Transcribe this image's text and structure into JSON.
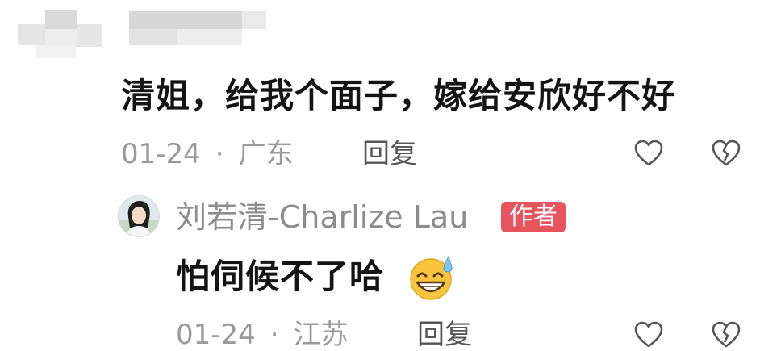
{
  "comment": {
    "text": "清姐，给我个面子，嫁给安欣好不好",
    "date": "01-24",
    "separator": "·",
    "location": "广东",
    "reply_label": "回复",
    "like_icon": "heart-outline-icon",
    "dislike_icon": "broken-heart-icon"
  },
  "reply": {
    "author_name": "刘若清-Charlize Lau",
    "author_badge": "作者",
    "badge_color": "#e8545e",
    "text": "怕伺候不了哈",
    "emoji": "grinning-sweat-emoji",
    "date": "01-24",
    "separator": "·",
    "location": "江苏",
    "reply_label": "回复",
    "like_icon": "heart-outline-icon",
    "dislike_icon": "broken-heart-icon"
  }
}
